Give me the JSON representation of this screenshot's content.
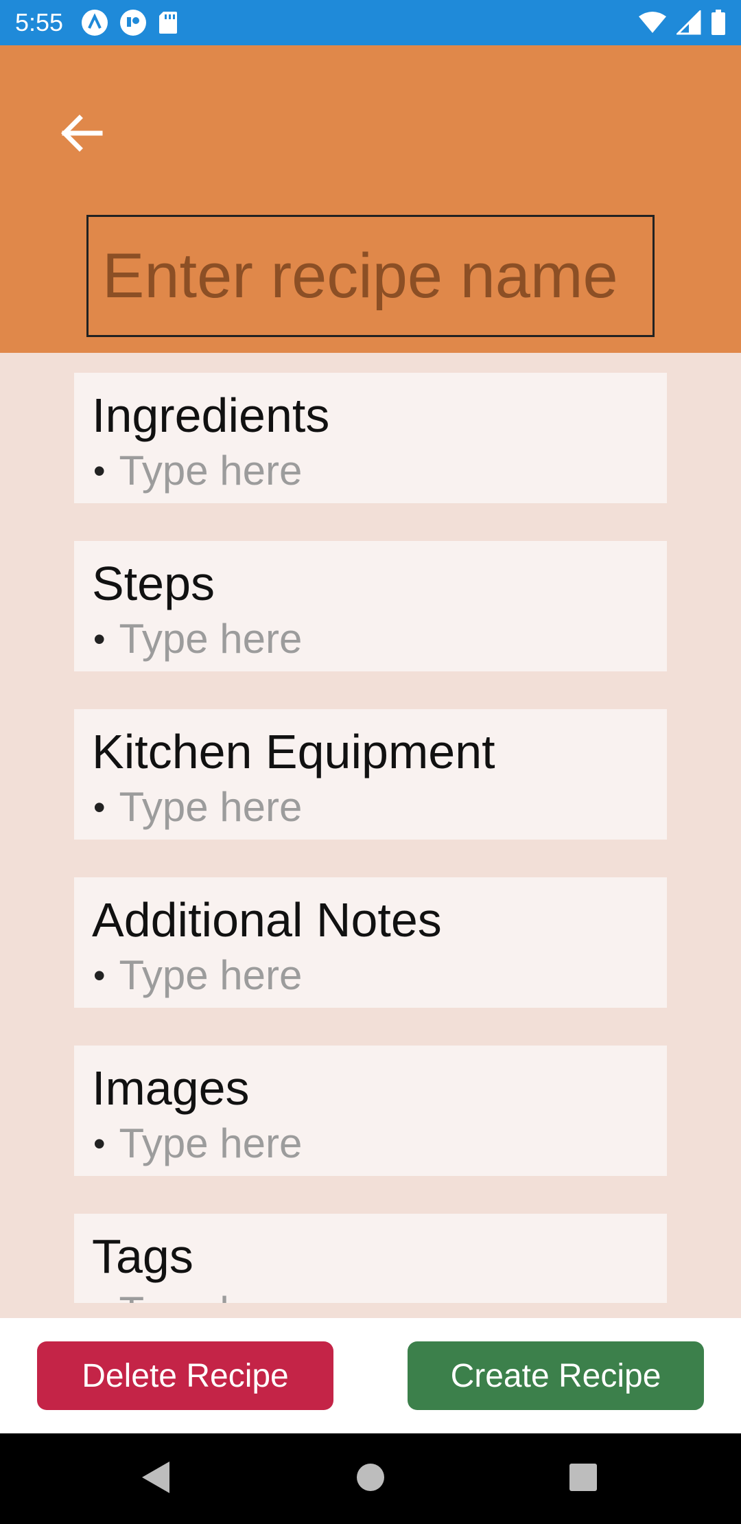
{
  "status_bar": {
    "time": "5:55",
    "left_icons": [
      "autofill-icon",
      "account-icon",
      "sd-card-icon"
    ],
    "right_icons": [
      "wifi-icon",
      "signal-icon",
      "battery-icon"
    ]
  },
  "header": {
    "back_icon": "arrow-back-icon",
    "recipe_name_placeholder": "Enter recipe name",
    "recipe_name_value": ""
  },
  "sections": [
    {
      "title": "Ingredients",
      "bullet": "•",
      "placeholder": "Type here"
    },
    {
      "title": "Steps",
      "bullet": "•",
      "placeholder": "Type here"
    },
    {
      "title": "Kitchen Equipment",
      "bullet": "•",
      "placeholder": "Type here"
    },
    {
      "title": "Additional Notes",
      "bullet": "•",
      "placeholder": "Type here"
    },
    {
      "title": "Images",
      "bullet": "•",
      "placeholder": "Type here"
    },
    {
      "title": "Tags",
      "bullet": "•",
      "placeholder": "Type here"
    }
  ],
  "actions": {
    "delete_label": "Delete Recipe",
    "create_label": "Create Recipe"
  },
  "nav": {
    "icons": [
      "back-triangle-icon",
      "home-circle-icon",
      "recents-square-icon"
    ]
  },
  "colors": {
    "status_bar": "#1f8ad9",
    "header": "#e0884a",
    "content_bg": "#f2dfd7",
    "card_bg": "#f9f2f0",
    "delete": "#c42447",
    "create": "#3c804b"
  }
}
